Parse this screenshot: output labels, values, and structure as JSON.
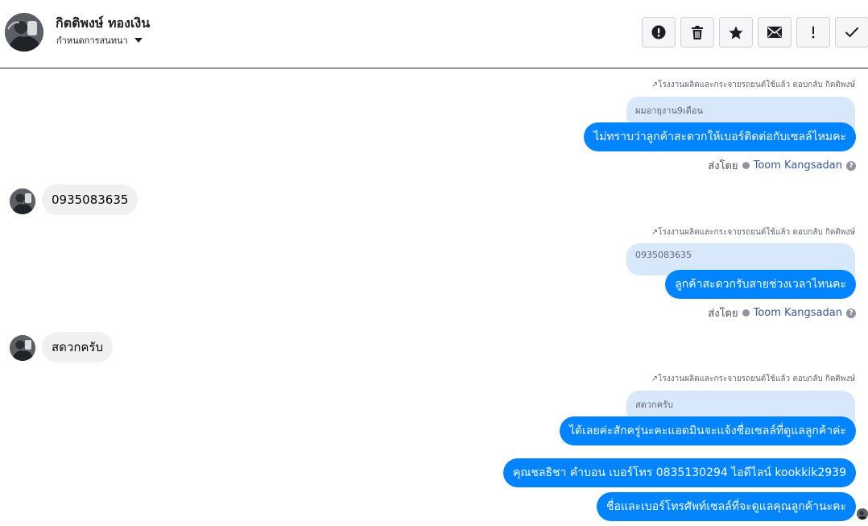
{
  "header": {
    "contact_name": "กิตติพงษ์ ทองเงิน",
    "assign_label": "กำหนดการสนทนา",
    "actions": [
      {
        "icon": "alert-circle-icon",
        "label": "spam"
      },
      {
        "icon": "trash-icon",
        "label": "delete"
      },
      {
        "icon": "star-icon",
        "label": "star"
      },
      {
        "icon": "envelope-icon",
        "label": "mark-unread"
      },
      {
        "icon": "exclamation-icon",
        "label": "important"
      },
      {
        "icon": "checkmark-icon",
        "label": "done"
      }
    ]
  },
  "messages": {
    "block1": {
      "meta": "โรงงานผลิตและกระจายรถยนต์ใช้แล้ว ตอบกลับ กิตติพงษ์",
      "quote": "ผมอายุงาน9เดือน",
      "text": "ไม่ทราบว่าลูกค้าสะดวกให้เบอร์ติดต่อกับเซลล์ไหมคะ",
      "sent_by_label": "ส่งโดย",
      "sent_by_name": "Toom Kangsadan"
    },
    "incoming1": {
      "text": "0935083635"
    },
    "block2": {
      "meta": "โรงงานผลิตและกระจายรถยนต์ใช้แล้ว ตอบกลับ กิตติพงษ์",
      "quote": "0935083635",
      "text": "ลูกค้าสะดวกรับสายช่วงเวลาไหนคะ",
      "sent_by_label": "ส่งโดย",
      "sent_by_name": "Toom Kangsadan"
    },
    "incoming2": {
      "text": "สดวกครับ"
    },
    "block3": {
      "meta": "โรงงานผลิตและกระจายรถยนต์ใช้แล้ว ตอบกลับ กิตติพงษ์",
      "quote": "สดวกครับ",
      "text": "ได้เลยค่ะสักครู่นะคะแอดมินจะแจ้งชื่อเซลล์ที่ดูแลลูกค้าค่ะ"
    },
    "outgoing4": {
      "text": "คุณชลธิชา คำบอน เบอร์โทร 0835130294 ไอดีไลน์ kookkik2939"
    },
    "outgoing5": {
      "text": "ชื่อและเบอร์โทรศัพท์เซลล์ที่จะดูแลคุณลูกค้านะคะ"
    }
  },
  "colors": {
    "outgoing_bubble": "#0084ff",
    "incoming_bubble": "#f1f0f0",
    "quote_bubble": "#d8e8fb",
    "link": "#385898"
  }
}
